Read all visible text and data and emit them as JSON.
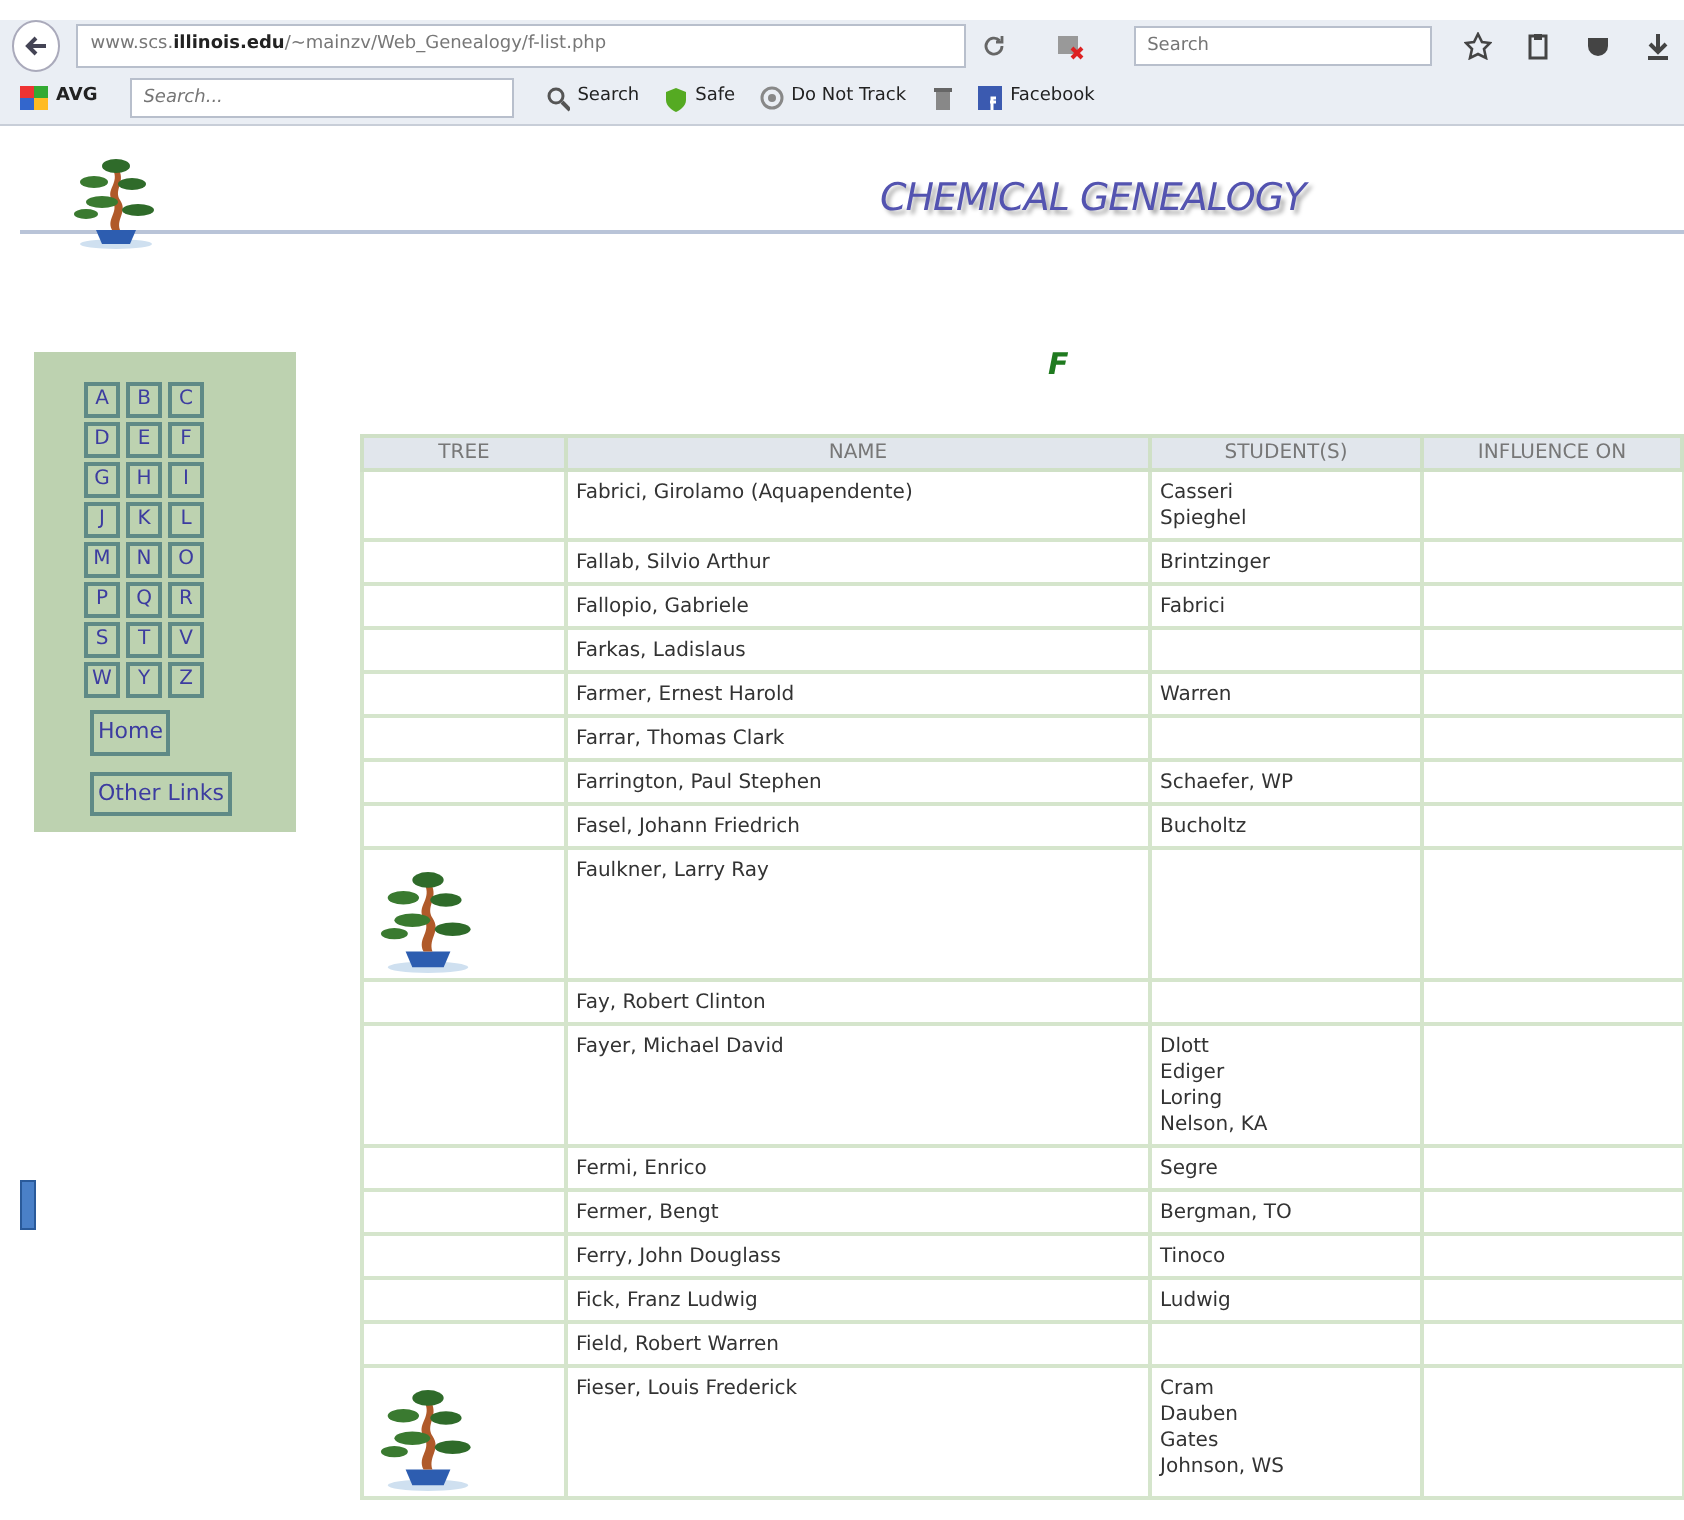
{
  "browser": {
    "url": "www.scs.**illinois.edu**/~mainzv/Web_Genealogy/f-list.php",
    "search_placeholder": "Search",
    "toolbar": {
      "brand": "AVG",
      "search_placeholder": "Search...",
      "items": [
        {
          "kind": "search",
          "label": "Search"
        },
        {
          "kind": "safe",
          "label": "Safe"
        },
        {
          "kind": "track",
          "label": "Do Not Track"
        },
        {
          "kind": "trash"
        },
        {
          "kind": "facebook",
          "label": "Facebook"
        }
      ]
    }
  },
  "page": {
    "title": "CHEMICAL GENEALOGY",
    "letter": "F",
    "sidebar": {
      "letters": [
        "A",
        "B",
        "C",
        "D",
        "E",
        "F",
        "G",
        "H",
        "I",
        "J",
        "K",
        "L",
        "M",
        "N",
        "O",
        "P",
        "Q",
        "R",
        "S",
        "T",
        "V",
        "W",
        "Y",
        "Z"
      ],
      "links": [
        "Home",
        "Other Links"
      ]
    },
    "table": {
      "columns": [
        "TREE",
        "NAME",
        "STUDENT(S)",
        "INFLUENCE ON"
      ],
      "rows": [
        {
          "tree": false,
          "name": "Fabrici, Girolamo (Aquapendente)",
          "students": [
            "Casseri",
            "Spieghel"
          ]
        },
        {
          "tree": false,
          "name": "Fallab, Silvio Arthur",
          "students": [
            "Brintzinger"
          ]
        },
        {
          "tree": false,
          "name": "Fallopio, Gabriele",
          "students": [
            "Fabrici"
          ]
        },
        {
          "tree": false,
          "name": "Farkas, Ladislaus",
          "students": []
        },
        {
          "tree": false,
          "name": "Farmer, Ernest Harold",
          "students": [
            "Warren"
          ]
        },
        {
          "tree": false,
          "name": "Farrar, Thomas Clark",
          "students": []
        },
        {
          "tree": false,
          "name": "Farrington, Paul Stephen",
          "students": [
            "Schaefer, WP"
          ]
        },
        {
          "tree": false,
          "name": "Fasel, Johann Friedrich",
          "students": [
            "Bucholtz"
          ]
        },
        {
          "tree": true,
          "name": "Faulkner, Larry Ray",
          "students": []
        },
        {
          "tree": false,
          "name": "Fay, Robert Clinton",
          "students": []
        },
        {
          "tree": false,
          "name": "Fayer, Michael David",
          "students": [
            "Dlott",
            "Ediger",
            "Loring",
            "Nelson, KA"
          ]
        },
        {
          "tree": false,
          "name": "Fermi, Enrico",
          "students": [
            "Segre"
          ]
        },
        {
          "tree": false,
          "name": "Fermer, Bengt",
          "students": [
            "Bergman, TO"
          ]
        },
        {
          "tree": false,
          "name": "Ferry, John Douglass",
          "students": [
            "Tinoco"
          ]
        },
        {
          "tree": false,
          "name": "Fick, Franz Ludwig",
          "students": [
            "Ludwig"
          ]
        },
        {
          "tree": false,
          "name": "Field, Robert Warren",
          "students": []
        },
        {
          "tree": true,
          "name": "Fieser, Louis Frederick",
          "students": [
            "Cram",
            "Dauben",
            "Gates",
            "Johnson, WS"
          ]
        }
      ]
    }
  }
}
